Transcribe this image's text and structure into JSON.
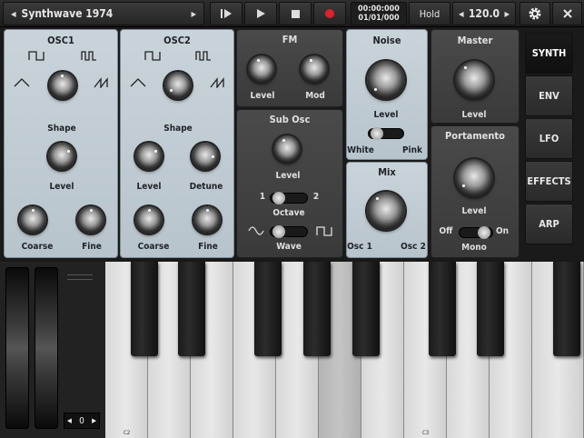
{
  "topbar": {
    "preset_name": "Synthwave 1974",
    "time_line1": "00:00:000",
    "time_line2": "01/01/000",
    "hold_label": "Hold",
    "tempo": "120.0"
  },
  "osc1": {
    "title": "OSC1",
    "shape": "Shape",
    "level": "Level",
    "coarse": "Coarse",
    "fine": "Fine"
  },
  "osc2": {
    "title": "OSC2",
    "shape": "Shape",
    "level": "Level",
    "detune": "Detune",
    "coarse": "Coarse",
    "fine": "Fine"
  },
  "fm": {
    "title": "FM",
    "level": "Level",
    "mod": "Mod"
  },
  "subosc": {
    "title": "Sub Osc",
    "level": "Level",
    "octave_low": "1",
    "octave_high": "2",
    "octave": "Octave",
    "wave": "Wave"
  },
  "noise": {
    "title": "Noise",
    "level": "Level",
    "white": "White",
    "pink": "Pink"
  },
  "mix": {
    "title": "Mix",
    "osc1": "Osc 1",
    "osc2": "Osc 2"
  },
  "master": {
    "title": "Master",
    "level": "Level"
  },
  "portamento": {
    "title": "Portamento",
    "level": "Level",
    "off": "Off",
    "on": "On",
    "mono": "Mono"
  },
  "tabs": [
    "SYNTH",
    "ENV",
    "LFO",
    "EFFECTS",
    "ARP"
  ],
  "keyboard": {
    "octave_value": "0",
    "c2_label": "C2",
    "c3_label": "C3"
  }
}
